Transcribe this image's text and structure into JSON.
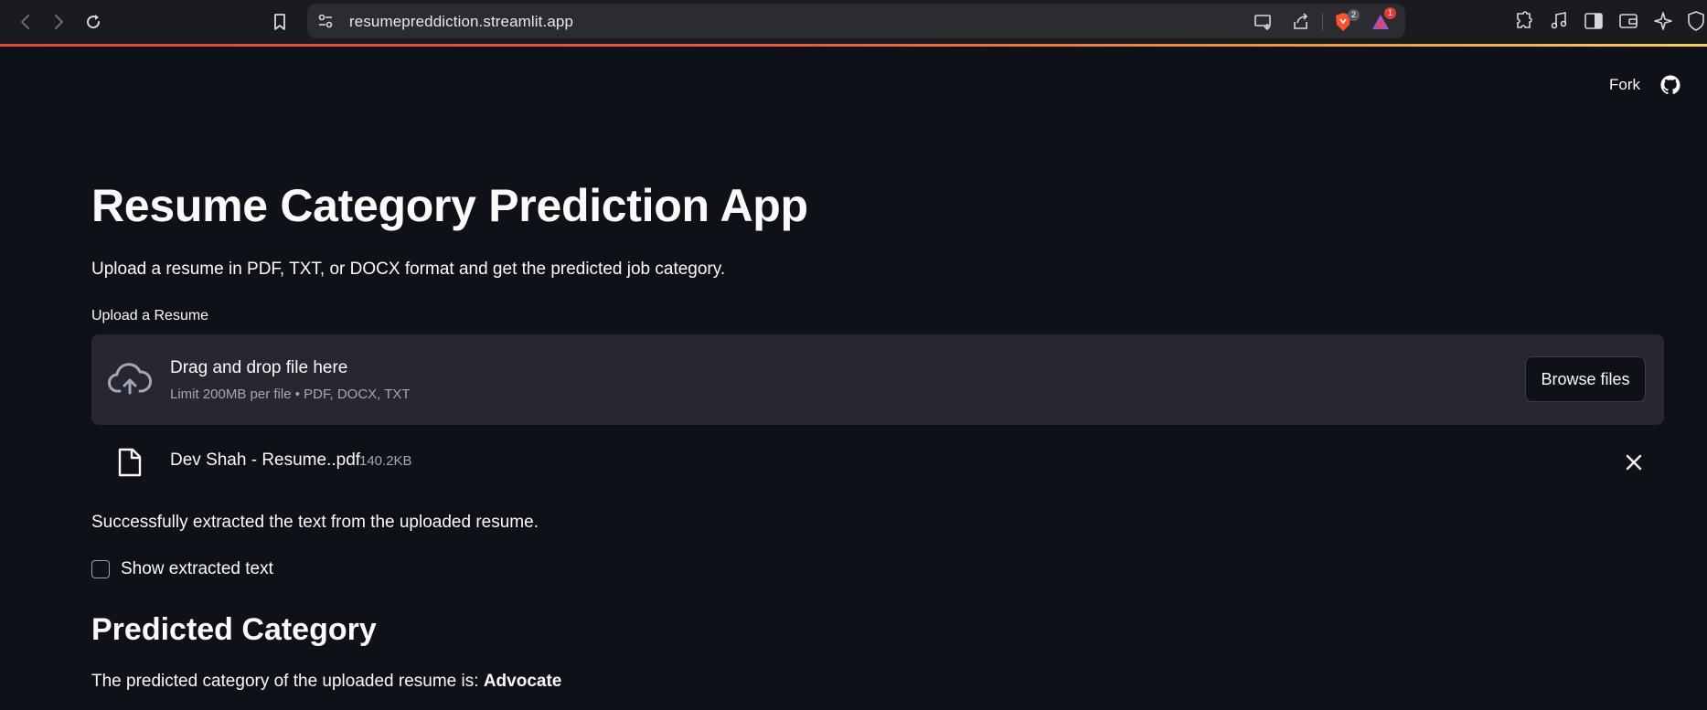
{
  "browser": {
    "url": "resumepreddiction.streamlit.app",
    "brave_badge": "2",
    "rewards_badge": "1",
    "icons": [
      "back-icon",
      "forward-icon",
      "reload-icon",
      "bookmark-icon",
      "site-settings-icon",
      "cast-icon",
      "share-icon",
      "brave-shields-icon",
      "brave-rewards-icon",
      "extensions-icon",
      "media-icon",
      "sidebar-icon",
      "wallet-icon",
      "leo-ai-icon",
      "vpn-icon"
    ]
  },
  "header": {
    "fork_label": "Fork",
    "icon": "github-icon"
  },
  "main": {
    "title": "Resume Category Prediction App",
    "subtitle": "Upload a resume in PDF, TXT, or DOCX format and get the predicted job category.",
    "uploader": {
      "label": "Upload a Resume",
      "dropzone_title": "Drag and drop file here",
      "dropzone_limit": "Limit 200MB per file • PDF, DOCX, TXT",
      "browse_label": "Browse files"
    },
    "file": {
      "name": "Dev Shah - Resume..pdf",
      "size": "140.2KB"
    },
    "success_text": "Successfully extracted the text from the uploaded resume.",
    "checkbox_label": "Show extracted text",
    "section_title": "Predicted Category",
    "prediction_prefix": "The predicted category of the uploaded resume is:",
    "prediction_value": "Advocate"
  },
  "colors": {
    "background": "#0e1117",
    "dropzone": "#262730",
    "text": "#fafafa",
    "muted": "#a3a8b8"
  }
}
